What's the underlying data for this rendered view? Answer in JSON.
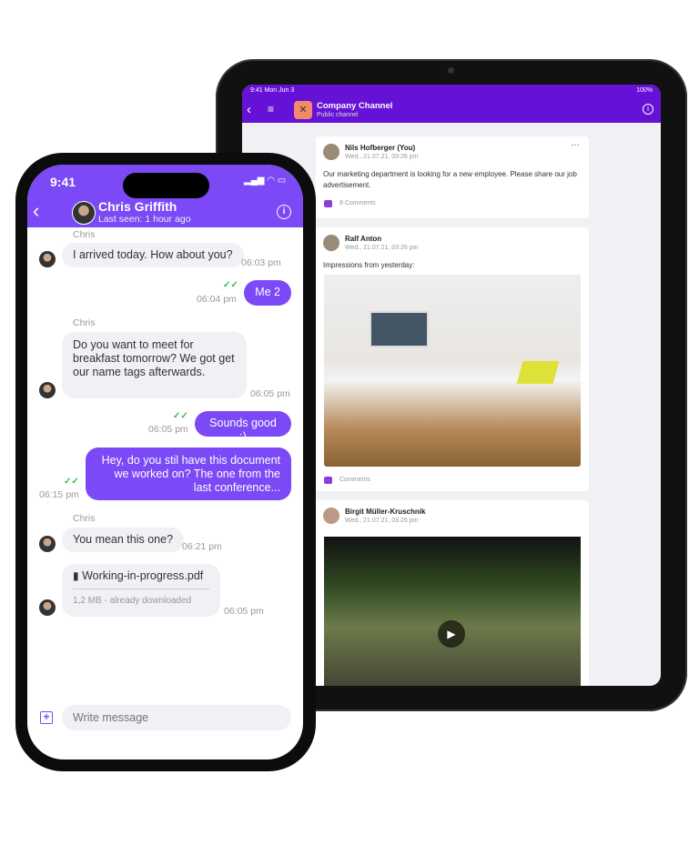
{
  "tablet": {
    "status_time": "9:41 Mon Jun 3",
    "status_battery": "100%",
    "channel_title": "Company Channel",
    "channel_subtitle": "Public channel",
    "posts": [
      {
        "author": "Nils Hofberger (You)",
        "date": "Wed., 21.07.21, 03:26 pm",
        "text": "Our marketing department is looking for a new employee. Please share our job advertisement.",
        "comments": "8 Comments"
      },
      {
        "author": "Ralf Anton",
        "date": "Wed., 21.07.21, 03:26 pm",
        "text": "Impressions from yesterday:",
        "comments": "Comments"
      },
      {
        "author": "Birgit Müller-Kruschnik",
        "date": "Wed., 21.07.21, 03:26 pm"
      }
    ]
  },
  "phone": {
    "status_time": "9:41",
    "contact_name": "Chris Griffith",
    "last_seen": "Last seen: 1 hour ago",
    "messages": [
      {
        "sender": "Chris",
        "text": "I arrived today. How about you?",
        "time": "06:03 pm"
      },
      {
        "text": "Me 2",
        "time": "06:04 pm"
      },
      {
        "sender": "Chris",
        "text": "Do you want to meet for breakfast tomorrow? We got get our name tags afterwards.",
        "time": "06:05 pm"
      },
      {
        "text": "Sounds good :)",
        "time": "06:05 pm"
      },
      {
        "text": "Hey, do you stil have this document we worked on? The one from the last conference...",
        "time": "06:15 pm"
      },
      {
        "sender": "Chris",
        "text": "You mean this one?",
        "time": "06:21 pm"
      },
      {
        "file_name": "Working-in-progress.pdf",
        "file_info": "1,2 MB - already downloaded",
        "time": "06:05 pm"
      }
    ],
    "input_placeholder": "Write message"
  },
  "colors": {
    "phone_accent": "#7b49f5",
    "tablet_accent": "#6512d6",
    "read_check": "#2fbf4a"
  }
}
